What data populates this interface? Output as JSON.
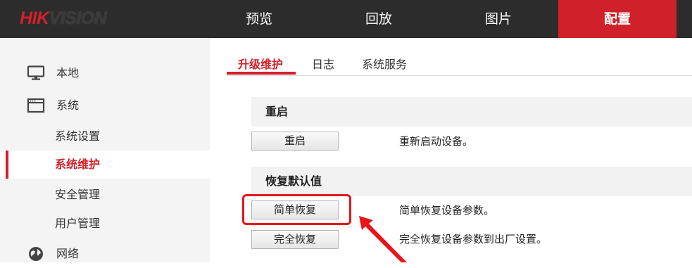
{
  "header": {
    "logo_part1": "HIK",
    "logo_part2": "VISION",
    "nav": [
      {
        "label": "预览",
        "active": false
      },
      {
        "label": "回放",
        "active": false
      },
      {
        "label": "图片",
        "active": false
      },
      {
        "label": "配置",
        "active": true
      }
    ]
  },
  "sidebar": {
    "items": [
      {
        "label": "本地",
        "icon": "monitor-icon",
        "level": 1
      },
      {
        "label": "系统",
        "icon": "window-icon",
        "level": 1
      },
      {
        "label": "系统设置",
        "level": 2
      },
      {
        "label": "系统维护",
        "level": 2,
        "active": true
      },
      {
        "label": "安全管理",
        "level": 2
      },
      {
        "label": "用户管理",
        "level": 2
      },
      {
        "label": "网络",
        "icon": "globe-icon",
        "level": 1
      }
    ]
  },
  "tabs": [
    {
      "label": "升级维护",
      "active": true
    },
    {
      "label": "日志",
      "active": false
    },
    {
      "label": "系统服务",
      "active": false
    }
  ],
  "sections": {
    "reboot": {
      "title": "重启",
      "button": "重启",
      "desc": "重新启动设备。"
    },
    "restore": {
      "title": "恢复默认值",
      "simple_button": "简单恢复",
      "simple_desc": "简单恢复设备参数。",
      "full_button": "完全恢复",
      "full_desc": "完全恢复设备参数到出厂设置。"
    }
  },
  "colors": {
    "accent": "#d0212a",
    "topbar": "#2c2c2c",
    "annotation": "#e8151b"
  }
}
